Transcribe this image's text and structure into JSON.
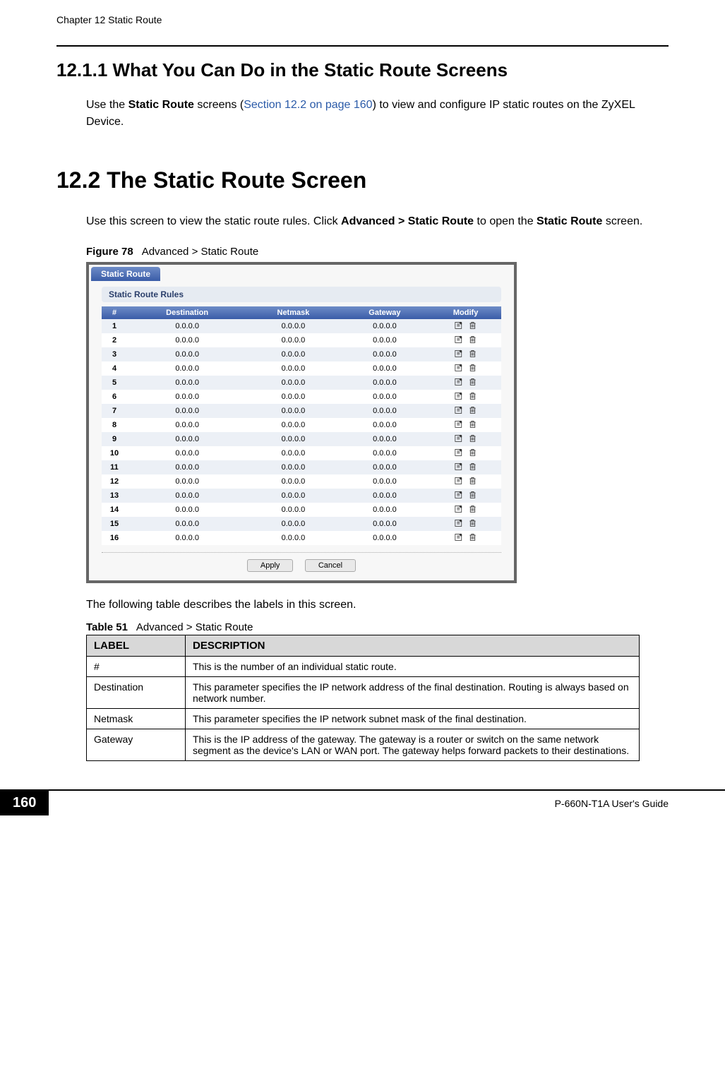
{
  "header": {
    "chapter": "Chapter 12 Static Route"
  },
  "section_12_1_1": {
    "heading": "12.1.1  What You Can Do in the Static Route Screens",
    "text_pre": "Use the ",
    "text_bold1": "Static Route",
    "text_mid1": " screens (",
    "text_link": "Section 12.2 on page 160",
    "text_mid2": ") to view and configure IP static routes on the ZyXEL Device."
  },
  "section_12_2": {
    "heading": "12.2  The Static Route Screen",
    "text_pre": "Use this screen to view the static route rules. Click ",
    "text_bold1": "Advanced > Static Route",
    "text_mid1": " to open the ",
    "text_bold2": "Static Route",
    "text_post": " screen."
  },
  "figure": {
    "label": "Figure 78",
    "caption": "Advanced > Static Route",
    "tab": "Static Route",
    "panel_title": "Static Route Rules",
    "columns": [
      "#",
      "Destination",
      "Netmask",
      "Gateway",
      "Modify"
    ],
    "rows": [
      {
        "n": "1",
        "d": "0.0.0.0",
        "m": "0.0.0.0",
        "g": "0.0.0.0"
      },
      {
        "n": "2",
        "d": "0.0.0.0",
        "m": "0.0.0.0",
        "g": "0.0.0.0"
      },
      {
        "n": "3",
        "d": "0.0.0.0",
        "m": "0.0.0.0",
        "g": "0.0.0.0"
      },
      {
        "n": "4",
        "d": "0.0.0.0",
        "m": "0.0.0.0",
        "g": "0.0.0.0"
      },
      {
        "n": "5",
        "d": "0.0.0.0",
        "m": "0.0.0.0",
        "g": "0.0.0.0"
      },
      {
        "n": "6",
        "d": "0.0.0.0",
        "m": "0.0.0.0",
        "g": "0.0.0.0"
      },
      {
        "n": "7",
        "d": "0.0.0.0",
        "m": "0.0.0.0",
        "g": "0.0.0.0"
      },
      {
        "n": "8",
        "d": "0.0.0.0",
        "m": "0.0.0.0",
        "g": "0.0.0.0"
      },
      {
        "n": "9",
        "d": "0.0.0.0",
        "m": "0.0.0.0",
        "g": "0.0.0.0"
      },
      {
        "n": "10",
        "d": "0.0.0.0",
        "m": "0.0.0.0",
        "g": "0.0.0.0"
      },
      {
        "n": "11",
        "d": "0.0.0.0",
        "m": "0.0.0.0",
        "g": "0.0.0.0"
      },
      {
        "n": "12",
        "d": "0.0.0.0",
        "m": "0.0.0.0",
        "g": "0.0.0.0"
      },
      {
        "n": "13",
        "d": "0.0.0.0",
        "m": "0.0.0.0",
        "g": "0.0.0.0"
      },
      {
        "n": "14",
        "d": "0.0.0.0",
        "m": "0.0.0.0",
        "g": "0.0.0.0"
      },
      {
        "n": "15",
        "d": "0.0.0.0",
        "m": "0.0.0.0",
        "g": "0.0.0.0"
      },
      {
        "n": "16",
        "d": "0.0.0.0",
        "m": "0.0.0.0",
        "g": "0.0.0.0"
      }
    ],
    "apply_label": "Apply",
    "cancel_label": "Cancel",
    "icon_edit_name": "edit-icon",
    "icon_delete_name": "delete-icon"
  },
  "table_intro": "The following table describes the labels in this screen.",
  "table51": {
    "label": "Table 51",
    "caption": "Advanced > Static Route",
    "header_label": "LABEL",
    "header_desc": "DESCRIPTION",
    "rows": [
      {
        "label": "#",
        "desc": "This is the number of an individual static route."
      },
      {
        "label": "Destination",
        "desc": "This parameter specifies the IP network address of the final destination. Routing is always based on network number."
      },
      {
        "label": "Netmask",
        "desc": "This parameter specifies the IP network subnet mask of the final destination."
      },
      {
        "label": "Gateway",
        "desc": "This is the IP address of the gateway. The gateway is a router or switch on the same network segment as the device's LAN or WAN port. The gateway helps forward packets to their destinations."
      }
    ]
  },
  "footer": {
    "page_number": "160",
    "guide": "P-660N-T1A User's Guide"
  },
  "icons": {
    "edit_svg": "<svg viewBox='0 0 16 16'><rect x='1' y='3' width='11' height='11' fill='none' stroke='#333' stroke-width='1'/><path d='M4 6h5M4 8h5M4 10h5' stroke='#333' stroke-width='1'/><path d='M10 2l3 3-2 2-3-3z' fill='#333'/></svg>",
    "delete_svg": "<svg viewBox='0 0 16 16'><rect x='4' y='5' width='8' height='9' fill='none' stroke='#333' stroke-width='1'/><path d='M3 5h10M6 3h4v2H6zM6 7v5M8 7v5M10 7v5' stroke='#333' stroke-width='1' fill='none'/></svg>"
  }
}
